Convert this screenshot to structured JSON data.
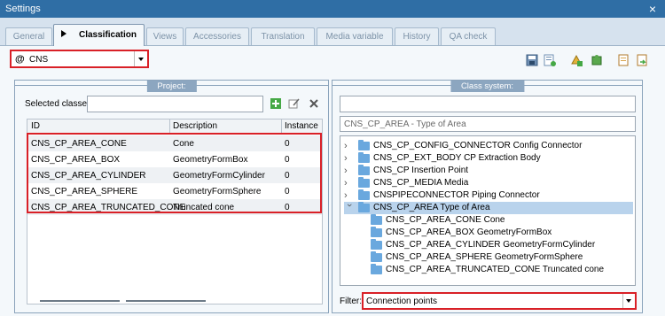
{
  "window": {
    "title": "Settings"
  },
  "tabs": [
    {
      "label": "General",
      "active": false
    },
    {
      "label": "Classification",
      "active": true
    },
    {
      "label": "Views",
      "active": false
    },
    {
      "label": "Accessories",
      "active": false
    },
    {
      "label": "Translation",
      "active": false
    },
    {
      "label": "Media variable",
      "active": false
    },
    {
      "label": "History",
      "active": false
    },
    {
      "label": "QA check",
      "active": false
    }
  ],
  "class_selector": {
    "prefix": "@",
    "value": "CNS"
  },
  "project": {
    "title": "Project:",
    "selected_classes_label": "Selected classes",
    "columns": [
      "ID",
      "Description",
      "Instance"
    ],
    "rows": [
      {
        "id": "CNS_CP_AREA_CONE",
        "description": "Cone",
        "instance": "0"
      },
      {
        "id": "CNS_CP_AREA_BOX",
        "description": "GeometryFormBox",
        "instance": "0"
      },
      {
        "id": "CNS_CP_AREA_CYLINDER",
        "description": "GeometryFormCylinder",
        "instance": "0"
      },
      {
        "id": "CNS_CP_AREA_SPHERE",
        "description": "GeometryFormSphere",
        "instance": "0"
      },
      {
        "id": "CNS_CP_AREA_TRUNCATED_CONE",
        "description": "Truncated cone",
        "instance": "0"
      }
    ]
  },
  "class_system": {
    "title": "Class system:",
    "path": "CNS_CP_AREA - Type of Area",
    "tree": [
      {
        "label": "CNS_CP_CONFIG_CONNECTOR Config Connector",
        "expanded": false
      },
      {
        "label": "CNS_CP_EXT_BODY CP Extraction Body",
        "expanded": false
      },
      {
        "label": "CNS_CP Insertion Point",
        "expanded": false
      },
      {
        "label": "CNS_CP_MEDIA Media",
        "expanded": false
      },
      {
        "label": "CNSPIPECONNECTOR Piping Connector",
        "expanded": false
      },
      {
        "label": "CNS_CP_AREA Type of Area",
        "expanded": true,
        "selected": true
      }
    ],
    "children": [
      {
        "label": "CNS_CP_AREA_CONE Cone"
      },
      {
        "label": "CNS_CP_AREA_BOX GeometryFormBox"
      },
      {
        "label": "CNS_CP_AREA_CYLINDER GeometryFormCylinder"
      },
      {
        "label": "CNS_CP_AREA_SPHERE GeometryFormSphere"
      },
      {
        "label": "CNS_CP_AREA_TRUNCATED_CONE Truncated cone"
      }
    ],
    "filter_label": "Filter:",
    "filter_value": "Connection points"
  },
  "colors": {
    "accent_red": "#d92027",
    "title_bar": "#2f6ea5",
    "selection": "#b9d3ec"
  }
}
